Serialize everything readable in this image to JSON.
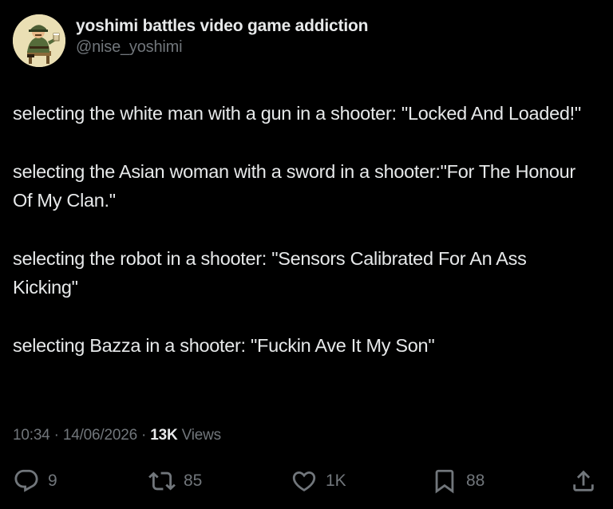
{
  "author": {
    "display_name": "yoshimi battles video game addiction",
    "handle": "@nise_yoshimi"
  },
  "tweet": {
    "paragraphs": [
      "selecting the white man with a gun in a shooter: \"Locked And Loaded!\"",
      "selecting the Asian woman with a sword in a shooter:\"For The Honour Of My Clan.\"",
      "selecting the robot in a shooter: \"Sensors Calibrated For An Ass Kicking\"",
      "selecting Bazza in a shooter: \"Fuckin Ave It My Son\""
    ],
    "time": "10:34",
    "date": "14/06/2026",
    "views_count": "13K",
    "views_label": "Views"
  },
  "actions": {
    "replies": "9",
    "reposts": "85",
    "likes": "1K",
    "bookmarks": "88"
  },
  "icons": {
    "reply": "reply-icon",
    "repost": "repost-icon",
    "like": "heart-icon",
    "bookmark": "bookmark-icon",
    "share": "share-icon"
  },
  "colors": {
    "background": "#000000",
    "text": "#e7e9ea",
    "secondary": "#71767b"
  }
}
